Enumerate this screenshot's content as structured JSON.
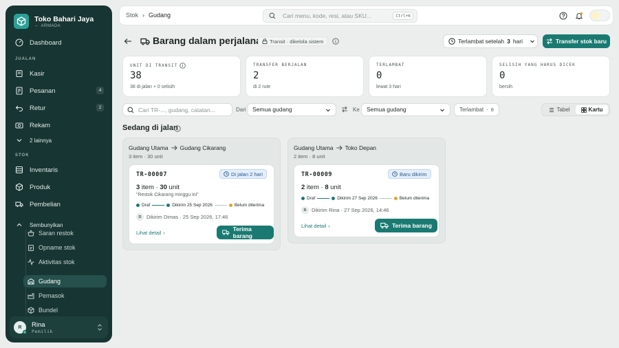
{
  "sidebar": {
    "brand_name": "Toko Bahari Jaya",
    "brand_sub": "ARMADA",
    "sections": {
      "jualan": "JUALAN",
      "stok": "STOK"
    },
    "items": [
      {
        "label": "Dashboard",
        "icon": "dashboard-icon"
      },
      {
        "label": "Kasir",
        "icon": "pos-icon"
      },
      {
        "label": "Pesanan",
        "icon": "orders-icon",
        "badge": "4"
      },
      {
        "label": "Retur",
        "icon": "return-icon",
        "badge": "2"
      },
      {
        "label": "Rekam",
        "icon": "record-icon"
      },
      {
        "label": "2 lainnya",
        "icon": "chevron-down-icon"
      },
      {
        "label": "Inventaris",
        "icon": "inventory-icon"
      },
      {
        "label": "Produk",
        "icon": "product-icon"
      },
      {
        "label": "Pembelian",
        "icon": "truck-icon"
      },
      {
        "label": "Sembunyikan",
        "icon": "chevron-up-icon"
      }
    ],
    "sub_items": [
      {
        "label": "Saran restok",
        "icon": "basket-icon"
      },
      {
        "label": "Opname stok",
        "icon": "clipboard-icon"
      },
      {
        "label": "Aktivitas stok",
        "icon": "activity-icon"
      },
      {
        "label": "Gudang",
        "icon": "warehouse-icon",
        "active": true
      },
      {
        "label": "Pemasok",
        "icon": "factory-icon"
      },
      {
        "label": "Bundel",
        "icon": "box-icon"
      }
    ],
    "user": {
      "initial": "R",
      "name": "Rina",
      "role": "Pemilik"
    }
  },
  "topbar": {
    "breadcrumb": [
      "Stok",
      "Gudang"
    ],
    "search_placeholder": "Cari menu, kode, resi, atau SKU...",
    "shortcut": "Ctrl+K"
  },
  "header": {
    "title": "Barang dalam perjalanan",
    "chip": "Transit · dikelola sistem",
    "late_prefix": "Terlambat setelah",
    "late_value": "3",
    "late_unit": "hari",
    "primary_button": "Transfer stok baru"
  },
  "stats": [
    {
      "label": "UNIT DI TRANSIT",
      "value": "38",
      "sub": "38 di jalan + 0 selisih"
    },
    {
      "label": "TRANSFER BERJALAN",
      "value": "2",
      "sub": "di 2 rute"
    },
    {
      "label": "TERLAMBAT",
      "value": "0",
      "sub": "lewat 3 hari"
    },
    {
      "label": "SELISIH YANG HARUS DICEK",
      "value": "0",
      "sub": "bersih"
    }
  ],
  "filters": {
    "search_placeholder": "Cari TR-..., gudang, catatan...",
    "from_label": "Dari",
    "from_value": "Semua gudang",
    "to_label": "Ke",
    "to_value": "Semua gudang",
    "late_label": "Terlambat",
    "late_count": "0",
    "view_table": "Tabel",
    "view_card": "Kartu"
  },
  "section_title": "Sedang di jalan",
  "lanes": [
    {
      "from": "Gudang Utama",
      "to": "Gudang Cikarang",
      "meta": "3 item · 30 unit",
      "card": {
        "code": "TR-00007",
        "status": "Di jalan 2 hari",
        "items": "3",
        "units": "30",
        "note": "\"Restok Cikarang minggu ini\"",
        "timeline": [
          "Draf",
          "Dikirim 25 Sep 2026",
          "Belum diterima"
        ],
        "sender_initial": "D",
        "sender": "Dikirim Dimas · 25 Sep 2026, 17:46",
        "detail": "Lihat detail",
        "receive": "Terima barang"
      }
    },
    {
      "from": "Gudang Utama",
      "to": "Toko Depan",
      "meta": "2 item · 8 unit",
      "card": {
        "code": "TR-00009",
        "status": "Baru dikirim",
        "items": "2",
        "units": "8",
        "timeline": [
          "Draf",
          "Dikirim 27 Sep 2026",
          "Belum diterima"
        ],
        "sender_initial": "R",
        "sender": "Dikirim Rina · 27 Sep 2026, 14:46",
        "detail": "Lihat detail",
        "receive": "Terima barang"
      }
    }
  ],
  "colors": {
    "sidebar": "#173532",
    "accent": "#1a7a72",
    "done": "#1a7a72",
    "pending": "#e0a32e"
  }
}
